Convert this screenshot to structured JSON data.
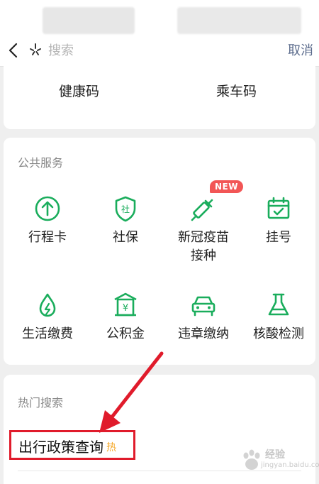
{
  "header": {
    "search_placeholder": "搜索",
    "cancel_label": "取消"
  },
  "codes": {
    "health_code": "健康码",
    "transit_code": "乘车码"
  },
  "public_services": {
    "title": "公共服务",
    "items": [
      {
        "label": "行程卡",
        "icon": "up-arrow-circle-icon"
      },
      {
        "label": "社保",
        "icon": "shield-icon"
      },
      {
        "label": "新冠疫苗\n接种",
        "icon": "syringe-icon",
        "badge": "NEW"
      },
      {
        "label": "挂号",
        "icon": "calendar-check-icon"
      },
      {
        "label": "生活缴费",
        "icon": "droplet-bolt-icon"
      },
      {
        "label": "公积金",
        "icon": "yuan-building-icon"
      },
      {
        "label": "违章缴纳",
        "icon": "car-icon"
      },
      {
        "label": "核酸检测",
        "icon": "flask-icon"
      }
    ]
  },
  "hot_search": {
    "title": "热门搜索",
    "items": [
      {
        "label": "出行政策查询",
        "tag": "热"
      }
    ]
  },
  "watermark": {
    "text": "经验",
    "url": "jingyan.baidu.com"
  },
  "colors": {
    "accent_green": "#1aad5c",
    "badge_red": "#f25656",
    "highlight_red": "#e01b2b",
    "hot_tag_orange": "#f5a623",
    "cancel_blue": "#5b6b8c"
  }
}
